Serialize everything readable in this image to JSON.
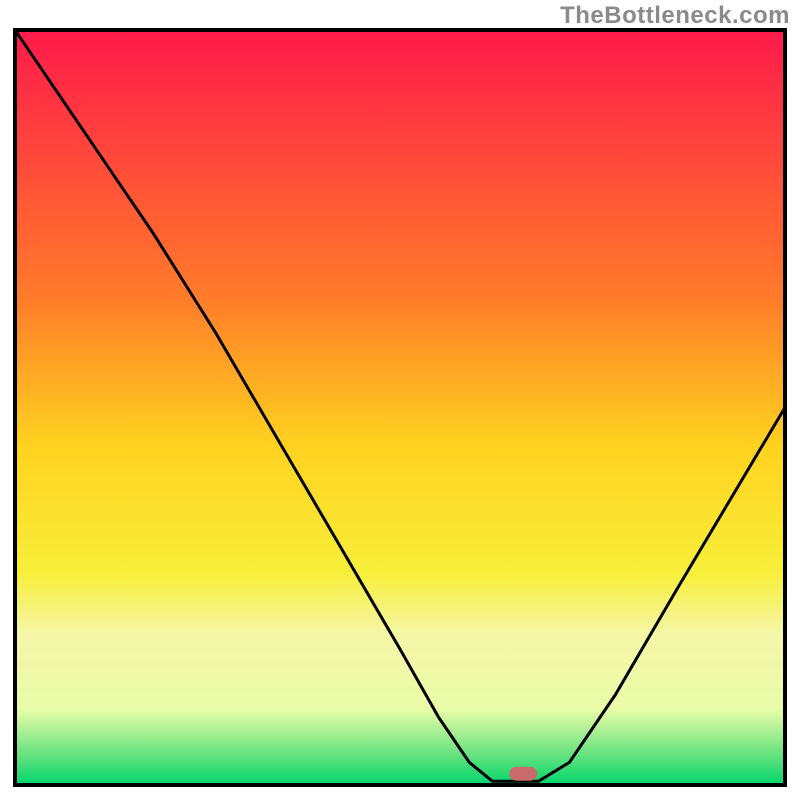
{
  "watermark": "TheBottleneck.com",
  "chart_data": {
    "type": "line",
    "title": "",
    "xlabel": "",
    "ylabel": "",
    "xlim": [
      0,
      100
    ],
    "ylim": [
      0,
      100
    ],
    "gradient_stops": [
      {
        "offset": 0,
        "color": "#ff1a4b"
      },
      {
        "offset": 35,
        "color": "#ff7a2a"
      },
      {
        "offset": 55,
        "color": "#ffd21f"
      },
      {
        "offset": 72,
        "color": "#f7ef3a"
      },
      {
        "offset": 80,
        "color": "#f5f6a8"
      },
      {
        "offset": 90,
        "color": "#e9fca8"
      },
      {
        "offset": 96,
        "color": "#66e27f"
      },
      {
        "offset": 100,
        "color": "#00d66b"
      }
    ],
    "curve": [
      {
        "x": 0,
        "y": 100
      },
      {
        "x": 8,
        "y": 88
      },
      {
        "x": 18,
        "y": 73
      },
      {
        "x": 26,
        "y": 60
      },
      {
        "x": 34,
        "y": 46
      },
      {
        "x": 42,
        "y": 32
      },
      {
        "x": 50,
        "y": 18
      },
      {
        "x": 55,
        "y": 9
      },
      {
        "x": 59,
        "y": 3
      },
      {
        "x": 62,
        "y": 0.5
      },
      {
        "x": 68,
        "y": 0.5
      },
      {
        "x": 72,
        "y": 3
      },
      {
        "x": 78,
        "y": 12
      },
      {
        "x": 86,
        "y": 26
      },
      {
        "x": 93,
        "y": 38
      },
      {
        "x": 100,
        "y": 50
      }
    ],
    "marker": {
      "x": 66,
      "y": 1.5,
      "color": "#c96b6b"
    },
    "frame": {
      "color": "#000000",
      "width": 4
    }
  }
}
